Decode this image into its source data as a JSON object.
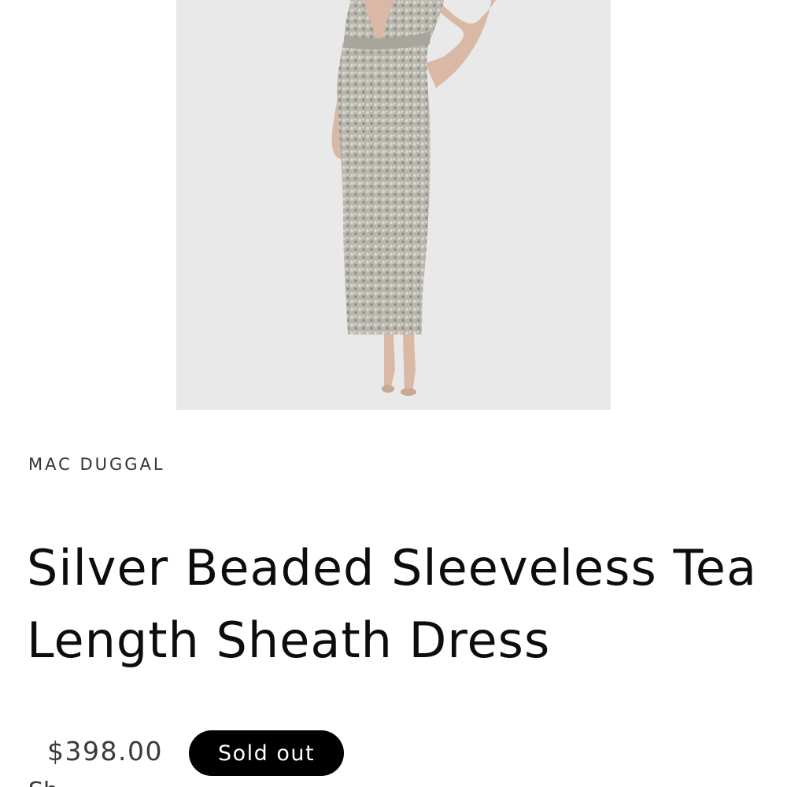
{
  "product": {
    "image": {
      "alt": "Model wearing a silver beaded sleeveless sheath dress",
      "background_color": "#e9e9e9"
    },
    "vendor": "MAC DUGGAL",
    "title": "Silver Beaded Sleeveless Tea Length Sheath Dress",
    "price": "$398.00",
    "badge": "Sold out",
    "next_line_partial": "Sh"
  },
  "colors": {
    "badge_background": "#000000",
    "badge_text": "#ffffff",
    "text_primary": "#0d0d0d",
    "text_secondary": "#333333"
  }
}
